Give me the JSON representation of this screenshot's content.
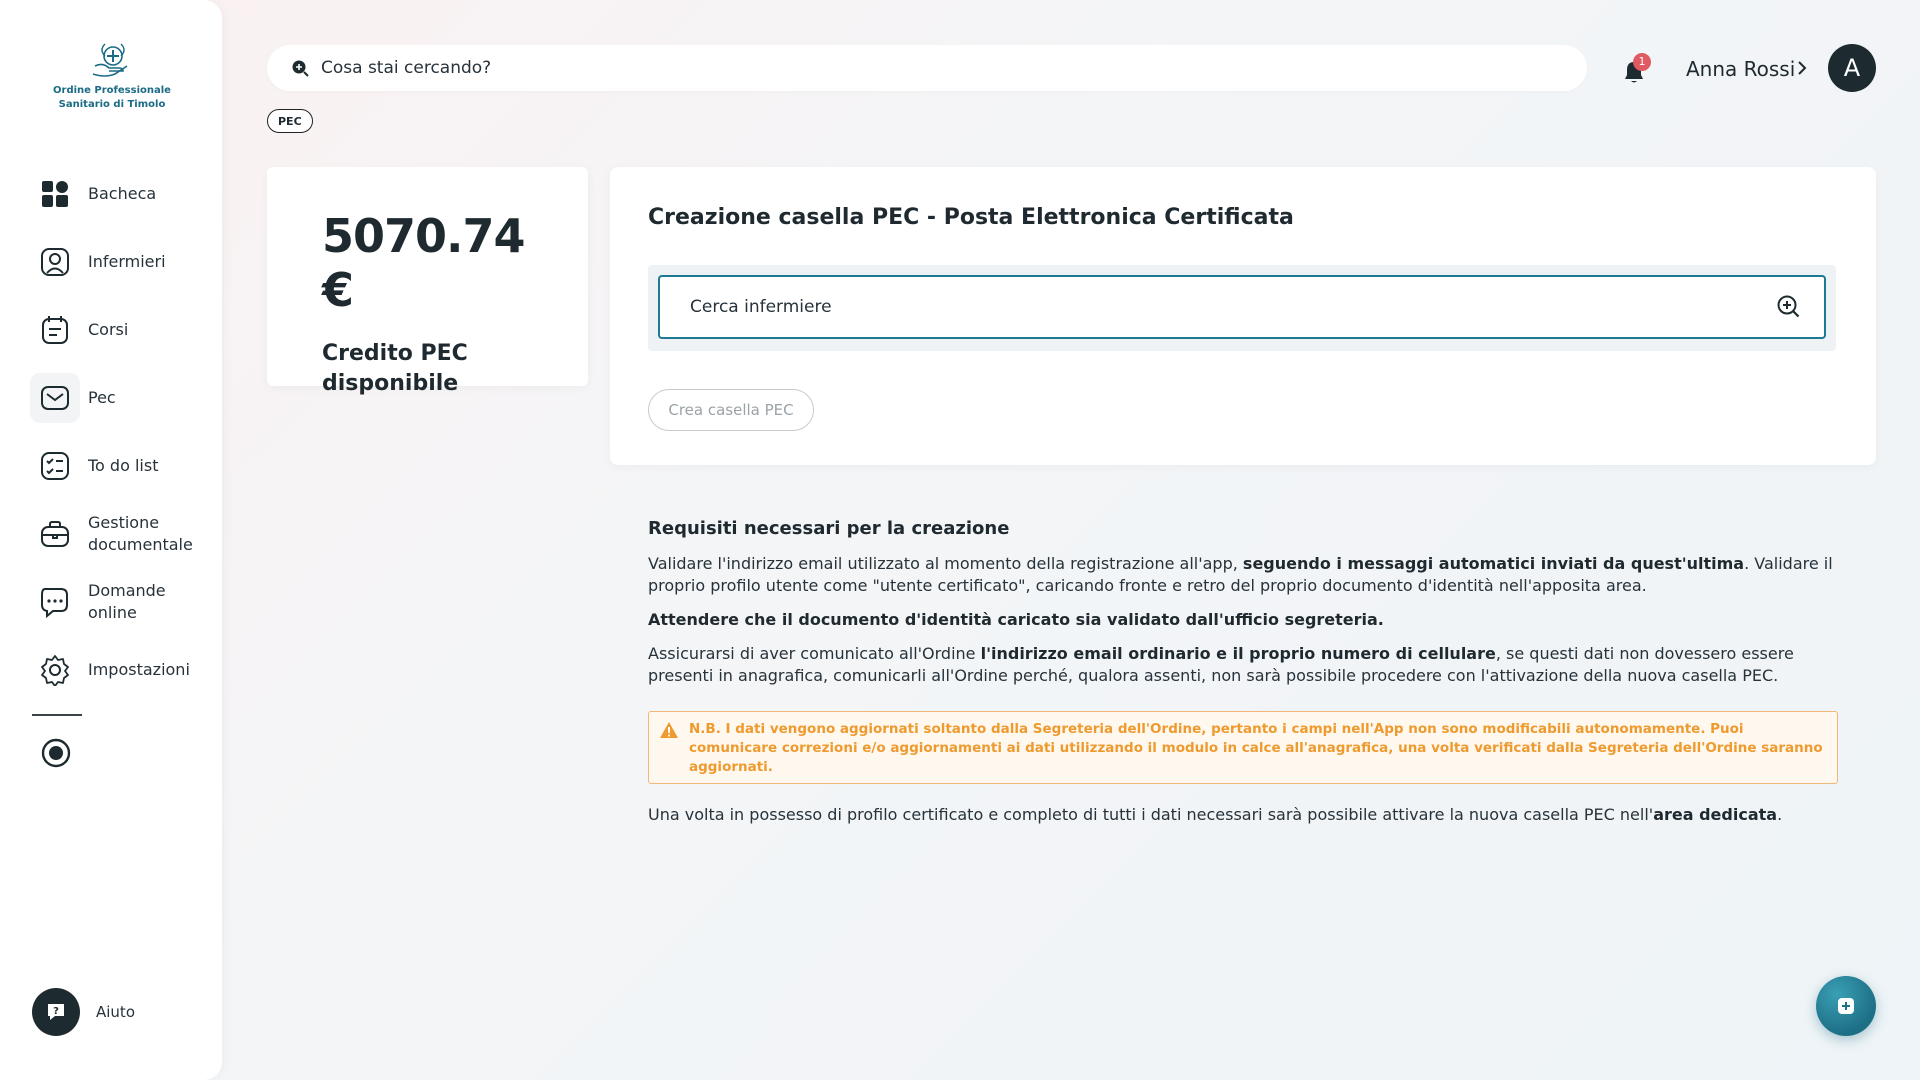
{
  "logo": {
    "line1": "Ordine Professionale",
    "line2": "Sanitario di Timolo",
    "icon": "caduceus-hands-icon"
  },
  "sidebar": {
    "items": [
      {
        "label": "Bacheca",
        "icon": "dashboard-icon",
        "active": false
      },
      {
        "label": "Infermieri",
        "icon": "user-icon",
        "active": false
      },
      {
        "label": "Corsi",
        "icon": "courses-icon",
        "active": false
      },
      {
        "label": "Pec",
        "icon": "mail-icon",
        "active": true
      },
      {
        "label": "To do list",
        "icon": "checklist-icon",
        "active": false
      },
      {
        "label": "Gestione\ndocumentale",
        "icon": "briefcase-icon",
        "active": false
      },
      {
        "label": "Domande\nonline",
        "icon": "chat-question-icon",
        "active": false
      },
      {
        "label": "Impostazioni",
        "icon": "gear-icon",
        "active": false
      }
    ],
    "help_label": "Aiuto"
  },
  "header": {
    "search_placeholder": "Cosa stai cercando?",
    "chip": "PEC",
    "notification_count": "1",
    "user_name": "Anna Rossi",
    "avatar_initial": "A"
  },
  "credit": {
    "amount": "5070.74 €",
    "label": "Credito PEC\ndisponibile"
  },
  "main": {
    "title": "Creazione casella PEC - Posta Elettronica Certificata",
    "nurse_search_placeholder": "Cerca infermiere",
    "create_button": "Crea casella PEC"
  },
  "requirements": {
    "title": "Requisiti necessari per la creazione",
    "p1_a": "Validare l'indirizzo email utilizzato al momento della registrazione all'app, ",
    "p1_b": "seguendo i messaggi automatici inviati da quest'ultima",
    "p1_c": ". Validare il proprio profilo utente come \"utente certificato\", caricando fronte e retro del proprio documento d'identità nell'apposita area.",
    "p2": "Attendere che il documento d'identità caricato sia validato dall'ufficio segreteria.",
    "p3_a": "Assicurarsi di aver comunicato all'Ordine ",
    "p3_b": "l'indirizzo email ordinario e il proprio numero di cellulare",
    "p3_c": ", se questi dati non dovessero essere presenti in anagrafica, comunicarli all'Ordine perché, qualora assenti, non sarà possibile procedere con l'attivazione della nuova casella PEC.",
    "warning": "N.B. I dati vengono aggiornati soltanto dalla Segreteria dell'Ordine, pertanto i campi nell'App non sono modificabili autonomamente. Puoi comunicare correzioni e/o aggiornamenti ai dati utilizzando il modulo in calce all'anagrafica, una volta verificati dalla Segreteria dell'Ordine saranno aggiornati.",
    "p4_a": "Una volta in possesso di profilo certificato e completo di tutti i dati necessari sarà possibile attivare la nuova casella PEC nell'",
    "p4_b": "area dedicata",
    "p4_c": "."
  },
  "colors": {
    "accent": "#1d7a93",
    "dark": "#1d2a2f",
    "warning": "#ee9a2e",
    "badge": "#e05a64"
  }
}
